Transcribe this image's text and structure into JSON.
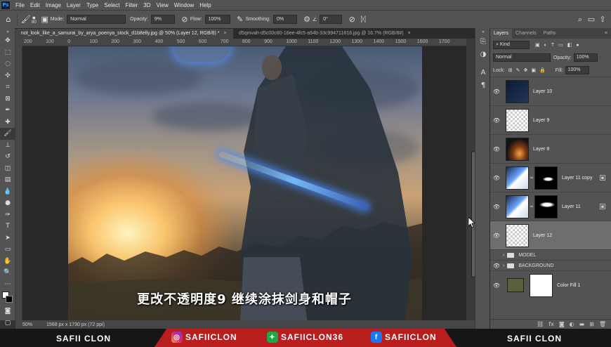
{
  "menubar": {
    "logo": "Ps",
    "items": [
      "File",
      "Edit",
      "Image",
      "Layer",
      "Type",
      "Select",
      "Filter",
      "3D",
      "View",
      "Window",
      "Help"
    ]
  },
  "options": {
    "brush_size": "80",
    "mode_label": "Mode:",
    "mode_value": "Normal",
    "opacity_label": "Opacity:",
    "opacity_value": "9%",
    "flow_label": "Flow:",
    "flow_value": "100%",
    "smoothing_label": "Smoothing:",
    "smoothing_value": "0%",
    "angle_value": "0°"
  },
  "tabs": [
    {
      "label": "not_look_like_a_samurai_by_arya_poenya_stock_d1b8elly.jpg @ 50% (Layer 12, RGB/8) *",
      "close": "×"
    },
    {
      "label": "d5qmvah-d5c00c80-16ee-4fc5-a94b-33c994711818.jpg @ 16.7% (RGB/8#)",
      "close": "×"
    }
  ],
  "ruler": {
    "labels": [
      "200",
      "100",
      "0",
      "100",
      "200",
      "300",
      "400",
      "500",
      "600",
      "700",
      "800",
      "900",
      "1000",
      "1100",
      "1200",
      "1300",
      "1400",
      "1500",
      "1600",
      "1700"
    ]
  },
  "canvas": {
    "subtitle": "更改不透明度9 继续涂抹剑身和帽子"
  },
  "status": {
    "zoom": "50%",
    "doc_info": "1568 px x 1730 px (72 ppi)"
  },
  "layers_panel": {
    "tabs": [
      "Layers",
      "Channels",
      "Paths"
    ],
    "kind_label": "Kind",
    "blend_mode": "Normal",
    "opacity_label": "Opacity:",
    "opacity_value": "100%",
    "lock_label": "Lock:",
    "fill_label": "Fill:",
    "fill_value": "100%",
    "layers": [
      {
        "name": "Layer 10"
      },
      {
        "name": "Layer 9"
      },
      {
        "name": "Layer 8"
      },
      {
        "name": "Layer 11 copy"
      },
      {
        "name": "Layer 11"
      },
      {
        "name": "Layer 12"
      }
    ],
    "groups": [
      "MODEL",
      "BACKGROUND"
    ],
    "fill_layer": "Color Fill 1"
  },
  "banner": {
    "left_name": "SAFII CLON",
    "instagram": "SAFIICLON",
    "other": "SAFIICLON36",
    "facebook": "SAFIICLON",
    "right_name": "SAFII CLON"
  },
  "colors": {
    "accent_red": "#b81e1e",
    "panel_bg": "#535353",
    "selected_layer": "#6e6e6e"
  }
}
